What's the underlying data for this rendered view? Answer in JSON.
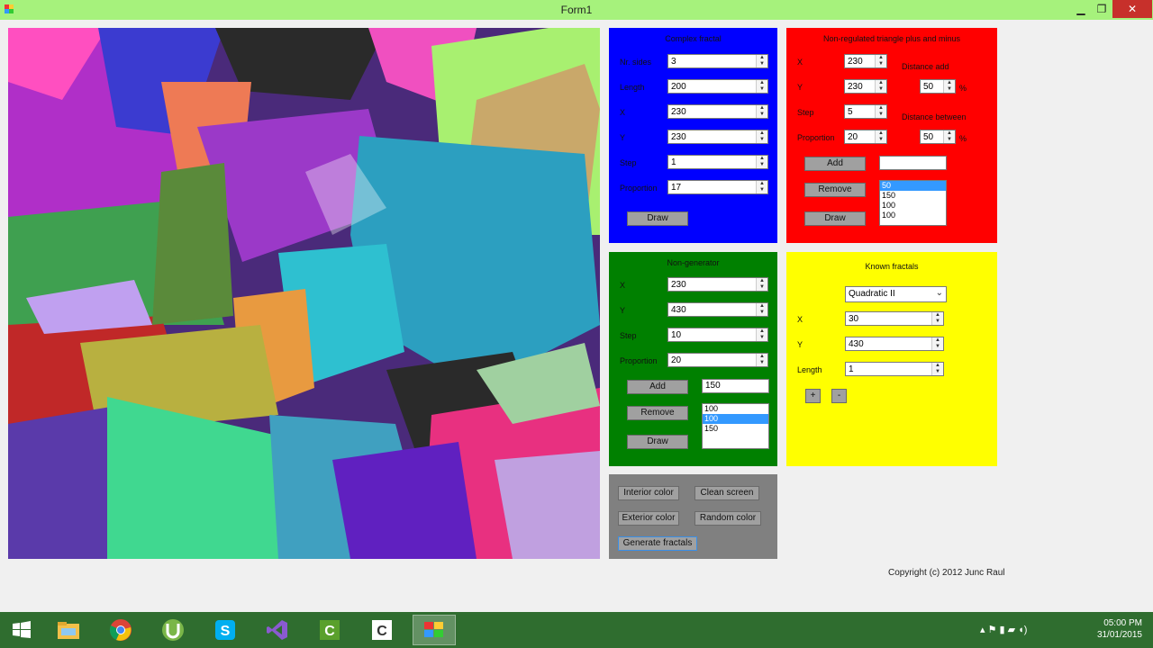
{
  "window": {
    "title": "Form1",
    "minimize": "▁",
    "maximize": "❐",
    "close": "✕"
  },
  "colors": {
    "titlebar": "#a6f27c",
    "blue_panel": "#0000ff",
    "red_panel": "#ff0000",
    "green_panel": "#008000",
    "yellow_panel": "#ffff00",
    "gray_panel": "#808080",
    "taskbar": "#2f6d2f"
  },
  "blue_panel": {
    "title": "Complex fractal",
    "fields": [
      {
        "label": "Nr. sides",
        "value": "3"
      },
      {
        "label": "Length",
        "value": "200"
      },
      {
        "label": "X",
        "value": "230"
      },
      {
        "label": "Y",
        "value": "230"
      },
      {
        "label": "Step",
        "value": "1"
      },
      {
        "label": "Proportion",
        "value": "17"
      }
    ],
    "draw": "Draw"
  },
  "red_panel": {
    "title": "Non-regulated triangle plus and minus",
    "fields": [
      {
        "label": "X",
        "value": "230"
      },
      {
        "label": "Y",
        "value": "230"
      },
      {
        "label": "Step",
        "value": "5"
      },
      {
        "label": "Proportion",
        "value": "20"
      }
    ],
    "dist_label_1": "Distance add",
    "dist_value_1": "50",
    "dist_unit_1": "%",
    "dist_label_2": "Distance between",
    "dist_value_2": "50",
    "dist_unit_2": "%",
    "add": "Add",
    "remove": "Remove",
    "draw": "Draw",
    "input_value": "",
    "list": [
      "50",
      "150",
      "100",
      "100"
    ],
    "selected_index": 0
  },
  "green_panel": {
    "title": "Non-generator",
    "fields": [
      {
        "label": "X",
        "value": "230"
      },
      {
        "label": "Y",
        "value": "430"
      },
      {
        "label": "Step",
        "value": "10"
      },
      {
        "label": "Proportion",
        "value": "20"
      }
    ],
    "add": "Add",
    "remove": "Remove",
    "draw": "Draw",
    "input_value": "150",
    "list": [
      "100",
      "100",
      "150"
    ],
    "selected_index": 1
  },
  "yellow_panel": {
    "title": "Known fractals",
    "select_value": "Quadratic II",
    "fields": [
      {
        "label": "X",
        "value": "30"
      },
      {
        "label": "Y",
        "value": "430"
      },
      {
        "label": "Length",
        "value": "1"
      }
    ],
    "plus": "+",
    "minus": "-"
  },
  "gray_panel": {
    "interior_color": "Interior color",
    "clean_screen": "Clean screen",
    "exterior_color": "Exterior color",
    "random_color": "Random color",
    "generate_fractals": "Generate fractals"
  },
  "copyright": "Copyright (c) 2012 Junc Raul",
  "taskbar": {
    "time": "05:00 PM",
    "date": "31/01/2015",
    "apps": [
      "start-icon",
      "file-explorer-icon",
      "chrome-icon",
      "utorrent-icon",
      "skype-icon",
      "visual-studio-icon",
      "camtasia-icon",
      "camtasia-recorder-icon",
      "fractal-app-icon"
    ]
  }
}
